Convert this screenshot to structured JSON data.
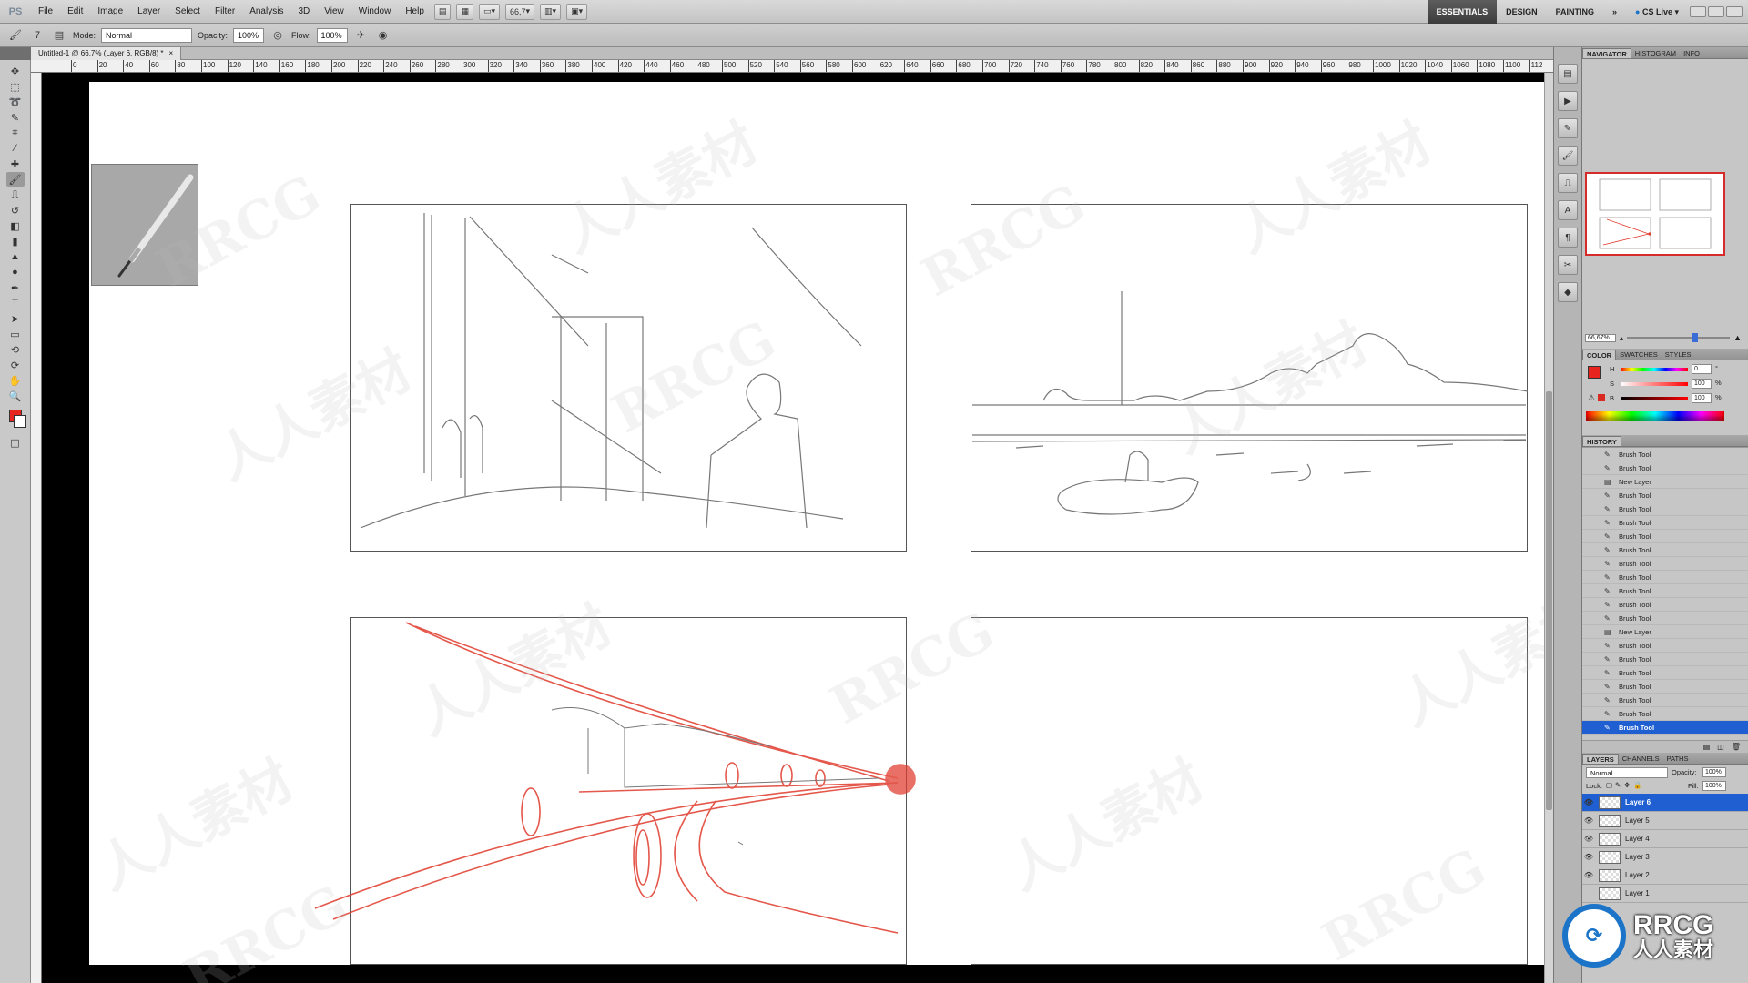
{
  "menubar": {
    "app_logo": "PS",
    "items": [
      "File",
      "Edit",
      "Image",
      "Layer",
      "Select",
      "Filter",
      "Analysis",
      "3D",
      "View",
      "Window",
      "Help"
    ],
    "zoom": "66,7",
    "workspaces": [
      "ESSENTIALS",
      "DESIGN",
      "PAINTING"
    ],
    "more": "»",
    "cs_live": "CS Live"
  },
  "options": {
    "brush_size": "7",
    "mode_label": "Mode:",
    "mode_value": "Normal",
    "opacity_label": "Opacity:",
    "opacity_value": "100%",
    "flow_label": "Flow:",
    "flow_value": "100%"
  },
  "document": {
    "tab_title": "Untitled-1 @ 66,7% (Layer 6, RGB/8) *",
    "close": "×"
  },
  "ruler": {
    "labels": [
      "0",
      "20",
      "40",
      "60",
      "80",
      "100",
      "120",
      "140",
      "160",
      "180",
      "200",
      "220",
      "240",
      "260",
      "280",
      "300",
      "320",
      "340",
      "360",
      "380",
      "400",
      "420",
      "440",
      "460",
      "480",
      "500",
      "520",
      "540",
      "560",
      "580",
      "600",
      "620",
      "640",
      "660",
      "680",
      "700",
      "720",
      "740",
      "760",
      "780",
      "800",
      "820",
      "840",
      "860",
      "880",
      "900",
      "920",
      "940",
      "960",
      "980",
      "1000",
      "1020",
      "1040",
      "1060",
      "1080",
      "1100",
      "112"
    ]
  },
  "navigator": {
    "tabs": [
      "NAVIGATOR",
      "HISTOGRAM",
      "INFO"
    ],
    "zoom_value": "66,67%"
  },
  "color_panel": {
    "tabs": [
      "COLOR",
      "SWATCHES",
      "STYLES"
    ],
    "h_label": "H",
    "h_value": "0",
    "h_unit": "°",
    "s_label": "S",
    "s_value": "100",
    "s_unit": "%",
    "b_label": "B",
    "b_value": "100",
    "b_unit": "%",
    "foreground": "#e8241e"
  },
  "history": {
    "title": "HISTORY",
    "items": [
      {
        "label": "Brush Tool",
        "icon": "brush"
      },
      {
        "label": "Brush Tool",
        "icon": "brush"
      },
      {
        "label": "New Layer",
        "icon": "layer"
      },
      {
        "label": "Brush Tool",
        "icon": "brush"
      },
      {
        "label": "Brush Tool",
        "icon": "brush"
      },
      {
        "label": "Brush Tool",
        "icon": "brush"
      },
      {
        "label": "Brush Tool",
        "icon": "brush"
      },
      {
        "label": "Brush Tool",
        "icon": "brush"
      },
      {
        "label": "Brush Tool",
        "icon": "brush"
      },
      {
        "label": "Brush Tool",
        "icon": "brush"
      },
      {
        "label": "Brush Tool",
        "icon": "brush"
      },
      {
        "label": "Brush Tool",
        "icon": "brush"
      },
      {
        "label": "Brush Tool",
        "icon": "brush"
      },
      {
        "label": "New Layer",
        "icon": "layer"
      },
      {
        "label": "Brush Tool",
        "icon": "brush"
      },
      {
        "label": "Brush Tool",
        "icon": "brush"
      },
      {
        "label": "Brush Tool",
        "icon": "brush"
      },
      {
        "label": "Brush Tool",
        "icon": "brush"
      },
      {
        "label": "Brush Tool",
        "icon": "brush"
      },
      {
        "label": "Brush Tool",
        "icon": "brush"
      },
      {
        "label": "Brush Tool",
        "icon": "brush",
        "selected": true
      }
    ]
  },
  "layers": {
    "tabs": [
      "LAYERS",
      "CHANNELS",
      "PATHS"
    ],
    "blend_mode": "Normal",
    "opacity_label": "Opacity:",
    "opacity_value": "100%",
    "lock_label": "Lock:",
    "fill_label": "Fill:",
    "fill_value": "100%",
    "items": [
      {
        "name": "Layer 6",
        "visible": true,
        "selected": true
      },
      {
        "name": "Layer 5",
        "visible": true
      },
      {
        "name": "Layer 4",
        "visible": true
      },
      {
        "name": "Layer 3",
        "visible": true
      },
      {
        "name": "Layer 2",
        "visible": true
      },
      {
        "name": "Layer 1",
        "visible": false
      }
    ]
  },
  "watermark": {
    "brand": "RRCG",
    "cn": "人人素材"
  }
}
